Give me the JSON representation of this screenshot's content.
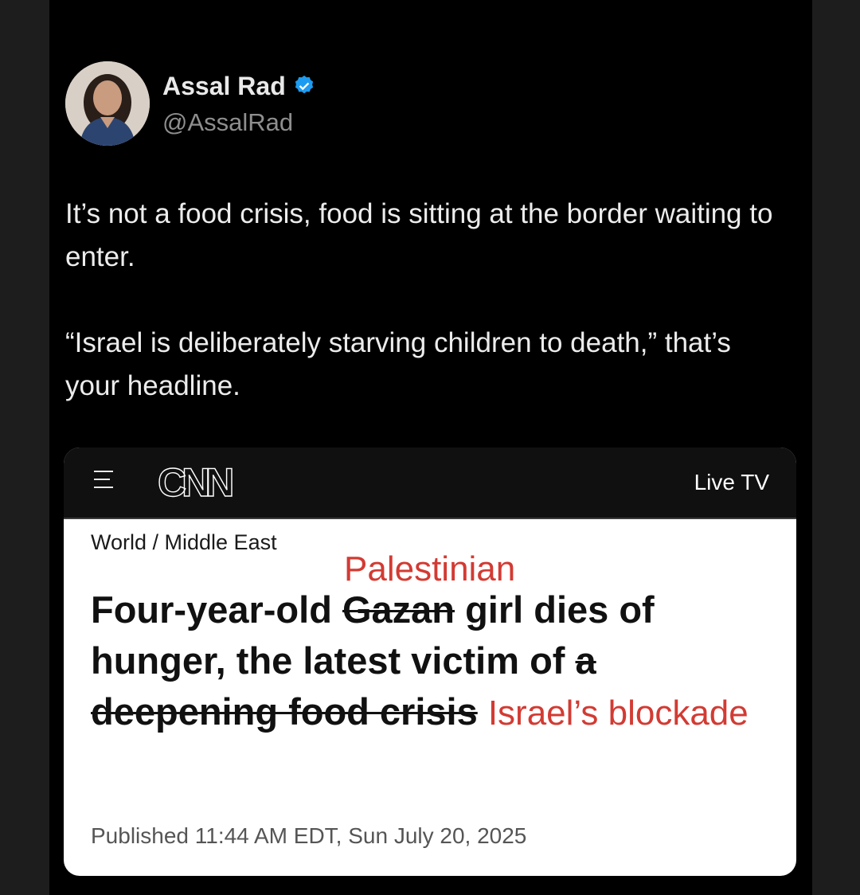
{
  "author": {
    "name": "Assal Rad",
    "handle": "@AssalRad"
  },
  "tweet": {
    "paragraph1": "It’s not a food crisis, food is sitting at the border waiting to enter.",
    "paragraph2": "“Israel is deliberately starving children to death,” that’s your headline."
  },
  "card": {
    "brand": "CNN",
    "live_tv": "Live TV",
    "breadcrumb": "World / Middle East",
    "insert_palestinian": "Palestinian",
    "headline_part1": "Four-year-old ",
    "struck_gazan": "Gazan",
    "headline_part2": " girl dies of hunger, the latest victim of ",
    "struck_a": "a",
    "struck_food_crisis": "deepening food crisis",
    "insert_blockade": "Israel’s blockade",
    "published": "Published 11:44 AM EDT, Sun July 20, 2025"
  },
  "colors": {
    "verified_badge": "#1d9bf0",
    "edit_red": "#d23b33"
  },
  "icons": [
    "verified-badge-icon",
    "menu-icon"
  ]
}
